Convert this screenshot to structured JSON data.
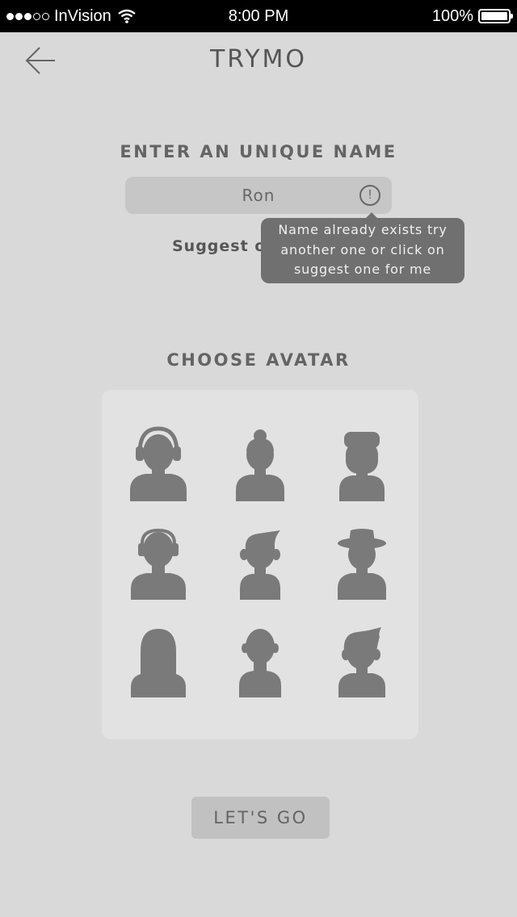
{
  "status_bar": {
    "carrier": "InVision",
    "time": "8:00 PM",
    "battery": "100%",
    "signal_bars_filled": 3,
    "signal_bars_total": 5
  },
  "header": {
    "title": "TRYMO",
    "back_icon": "arrow-left-icon"
  },
  "name_section": {
    "heading": "ENTER AN UNIQUE NAME",
    "input_value": "Ron",
    "warning_icon": "!",
    "suggest_label": "Suggest one for me",
    "tooltip_lines": [
      "Name already exists try",
      "another one or click on",
      "suggest one for me"
    ]
  },
  "avatar_section": {
    "heading": "CHOOSE AVATAR",
    "avatars": [
      {
        "name": "headphones"
      },
      {
        "name": "bun-hair"
      },
      {
        "name": "flat-top"
      },
      {
        "name": "headset"
      },
      {
        "name": "quiff"
      },
      {
        "name": "fedora"
      },
      {
        "name": "long-hair"
      },
      {
        "name": "bald"
      },
      {
        "name": "spiky-hair"
      }
    ]
  },
  "footer": {
    "go_label": "LET'S GO"
  },
  "colors": {
    "background": "#d9d9d9",
    "panel": "#e2e2e2",
    "avatar_fill": "#7a7a7a",
    "tooltip": "#707070",
    "input": "#c6c6c6"
  }
}
